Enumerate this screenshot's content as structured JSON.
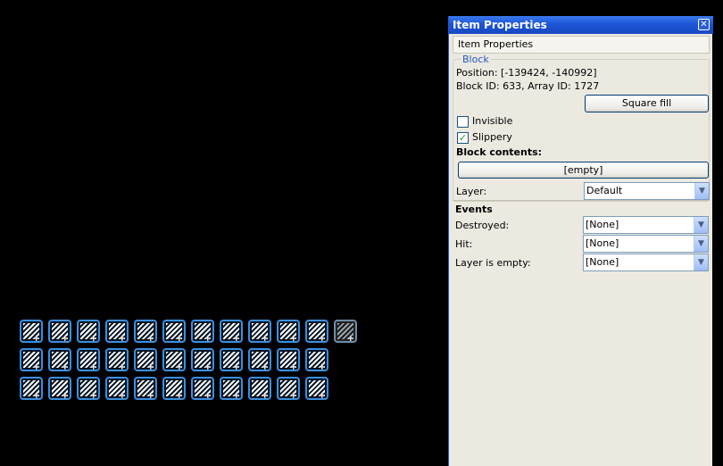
{
  "canvas": {
    "tiles": {
      "rows": 3,
      "columns": [
        12,
        11,
        11
      ],
      "faded_tile": {
        "row": 0,
        "col": 11
      }
    }
  },
  "panel": {
    "title": "Item Properties",
    "close_glyph": "✕",
    "header": "Item Properties",
    "block": {
      "legend": "Block",
      "position": "Position: [-139424, -140992]",
      "ids": "Block ID: 633, Array ID: 1727",
      "square_fill_label": "Square fill",
      "invisible": {
        "label": "Invisible",
        "checked": false
      },
      "slippery": {
        "label": "Slippery",
        "checked": true,
        "check_glyph": "✓"
      },
      "contents_label": "Block contents:",
      "contents_button": "[empty]"
    },
    "layer": {
      "label": "Layer:",
      "value": "Default"
    },
    "events": {
      "heading": "Events",
      "destroyed": {
        "label": "Destroyed:",
        "value": "[None]"
      },
      "hit": {
        "label": "Hit:",
        "value": "[None]"
      },
      "layer_empty": {
        "label": "Layer is empty:",
        "value": "[None]"
      }
    },
    "dropdown_glyph": "▼"
  }
}
